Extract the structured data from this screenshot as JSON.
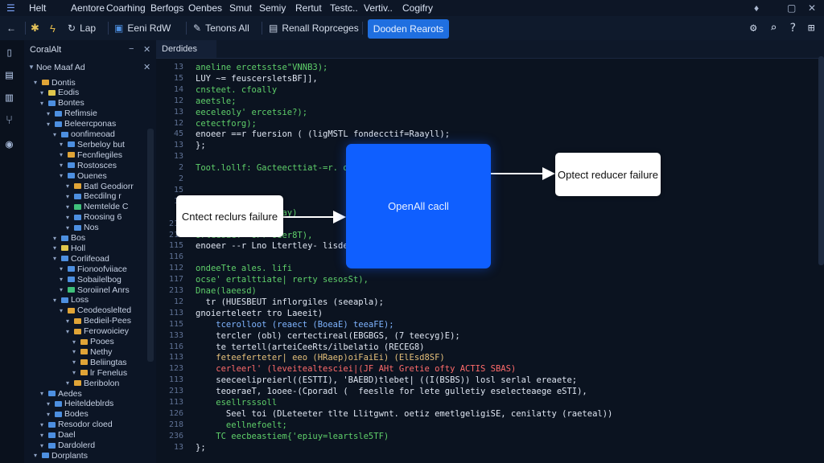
{
  "menu": [
    "Helt",
    "Aentore",
    "Coarhing",
    "Berfogs",
    "Oenbes",
    "Smut",
    "Semiy",
    "Rertut",
    "Testc..",
    "Vertiv..",
    "Cogifry"
  ],
  "toolbar": {
    "lap_label": "Lap",
    "eeni_label": "Eeni RdW",
    "tenons_label": "Tenons All",
    "renall_label": "Renall Roprceges",
    "primary_label": "Dooden Rearots"
  },
  "explorer": {
    "title": "CoralAlt",
    "root_label": "Noe Maaf Ad",
    "items": [
      {
        "label": "Dontis",
        "depth": 0,
        "color": "#e0a437"
      },
      {
        "label": "Eodis",
        "depth": 1,
        "color": "#e0c64c"
      },
      {
        "label": "Bontes",
        "depth": 1,
        "color": "#4d8fe0"
      },
      {
        "label": "Refimsie",
        "depth": 2,
        "color": "#4d8fe0"
      },
      {
        "label": "Beleercponas",
        "depth": 2,
        "color": "#4d8fe0"
      },
      {
        "label": "oonfimeoad",
        "depth": 3,
        "color": "#4d8fe0"
      },
      {
        "label": "Serbeloy but",
        "depth": 4,
        "color": "#4d8fe0"
      },
      {
        "label": "Fecnfiegiles",
        "depth": 4,
        "color": "#e0a437"
      },
      {
        "label": "Rostosces",
        "depth": 4,
        "color": "#4d8fe0"
      },
      {
        "label": "Ouenes",
        "depth": 4,
        "color": "#4d8fe0"
      },
      {
        "label": "Batl Geodiorr",
        "depth": 5,
        "color": "#e0a437"
      },
      {
        "label": "Becdilng r",
        "depth": 5,
        "color": "#4d8fe0"
      },
      {
        "label": "Nemtelde C",
        "depth": 5,
        "color": "#3fc07a"
      },
      {
        "label": "Roosing 6",
        "depth": 5,
        "color": "#4d8fe0"
      },
      {
        "label": "Nos",
        "depth": 5,
        "color": "#4d8fe0"
      },
      {
        "label": "Bos",
        "depth": 3,
        "color": "#4d8fe0"
      },
      {
        "label": "Holl",
        "depth": 3,
        "color": "#e0c64c"
      },
      {
        "label": "Corlifeoad",
        "depth": 3,
        "color": "#4d8fe0"
      },
      {
        "label": "Fionoofviiace",
        "depth": 4,
        "color": "#4d8fe0"
      },
      {
        "label": "Sobailelbog",
        "depth": 4,
        "color": "#4d8fe0"
      },
      {
        "label": "Soroiinel Anrs",
        "depth": 4,
        "color": "#3fc07a"
      },
      {
        "label": "Loss",
        "depth": 3,
        "color": "#4d8fe0"
      },
      {
        "label": "Ceodeoslelted",
        "depth": 4,
        "color": "#e0a437"
      },
      {
        "label": "Bedieil-Pees",
        "depth": 5,
        "color": "#e0a437"
      },
      {
        "label": "Ferowoiciey",
        "depth": 5,
        "color": "#e0a437"
      },
      {
        "label": "Pooes",
        "depth": 6,
        "color": "#e0a437"
      },
      {
        "label": "Nethy",
        "depth": 6,
        "color": "#e0a437"
      },
      {
        "label": "Beliingtas",
        "depth": 6,
        "color": "#e0a437"
      },
      {
        "label": "lr Fenelus",
        "depth": 6,
        "color": "#e0a437"
      },
      {
        "label": "Beribolon",
        "depth": 5,
        "color": "#e0a437"
      },
      {
        "label": "Aedes",
        "depth": 1,
        "color": "#4d8fe0"
      },
      {
        "label": "Heiteldeblrds",
        "depth": 2,
        "color": "#4d8fe0"
      },
      {
        "label": "Bodes",
        "depth": 2,
        "color": "#4d8fe0"
      },
      {
        "label": "Resodor cloed",
        "depth": 1,
        "color": "#4d8fe0"
      },
      {
        "label": "Dael",
        "depth": 1,
        "color": "#4d8fe0"
      },
      {
        "label": "Dardolerd",
        "depth": 1,
        "color": "#4d8fe0"
      },
      {
        "label": "Dorplants",
        "depth": 0,
        "color": "#4d8fe0"
      }
    ]
  },
  "editor": {
    "tab_label": "Derdides",
    "lines": [
      {
        "n": "13",
        "t": "aneline ercetsstse\"VNNB3);",
        "c": "kw"
      },
      {
        "n": "15",
        "t": "LUY ~= feuscersletsBF]],",
        "c": ""
      },
      {
        "n": "14",
        "t": "cnsteet. cfoally",
        "c": "kw"
      },
      {
        "n": "12",
        "t": "aeetsle;",
        "c": "kw"
      },
      {
        "n": "13",
        "t": "eeceleoly' ercetsie?);",
        "c": "kw"
      },
      {
        "n": "12",
        "t": "cetectforg);",
        "c": "kw"
      },
      {
        "n": "45",
        "t": "enoeer ==r fuersion ( (ligMSTL fondecctif=Raayll);",
        "c": ""
      },
      {
        "n": "13",
        "t": "};",
        "c": ""
      },
      {
        "n": "13",
        "t": "",
        "c": ""
      },
      {
        "n": "2",
        "t": "Toot.lollf: Gacteecttiat-=r. ooet",
        "c": "kw"
      },
      {
        "n": "2",
        "t": "",
        "c": ""
      },
      {
        "n": "15",
        "t": "",
        "c": ""
      },
      {
        "n": "13",
        "t": "",
        "c": ""
      },
      {
        "n": "",
        "t": "Andsie arsteetlraay)",
        "c": "kw"
      },
      {
        "n": "213",
        "t": "",
        "c": ""
      },
      {
        "n": "218",
        "t": "orleesaeT =oFf oeer8T),",
        "c": "kw"
      },
      {
        "n": "115",
        "t": "enoeer --r Lno Ltertley- lisdes(EMBBS),AO)",
        "c": ""
      },
      {
        "n": "116",
        "t": "",
        "c": ""
      },
      {
        "n": "112",
        "t": "ondeeTte ales. lifi",
        "c": "kw"
      },
      {
        "n": "117",
        "t": "ocse' ertalttiate| rerty sesosSt),",
        "c": "kw"
      },
      {
        "n": "213",
        "t": "Dnae(laeesd)",
        "c": "kw"
      },
      {
        "n": "12",
        "t": "  tr (HUESBEUT inflorgiles (seeapla);",
        "c": ""
      },
      {
        "n": "113",
        "t": "gnoierteleetr tro Laeeit)",
        "c": ""
      },
      {
        "n": "115",
        "t": "    tcerolloot (reaect (BoeaE) teeaFE);",
        "c": "fn"
      },
      {
        "n": "133",
        "t": "    tercler (obl) certectireal(EBGBGS, (7 teecyg)E);",
        "c": ""
      },
      {
        "n": "116",
        "t": "    te tertell(arteiCeeRts/ilbelatio (RECEG8)",
        "c": ""
      },
      {
        "n": "113",
        "t": "    feteeferteter| eeo (HRaep)oiFaiEi) (ElEsd8SF)",
        "c": "str"
      },
      {
        "n": "123",
        "t": "    cerleerl' (leveitealtesciei|(JF AHt Gretie ofty ACTIS SBAS)",
        "c": "red"
      },
      {
        "n": "113",
        "t": "    seeceelipreierl((ESTTI), 'BAEBD)tlebet| ((I(BSBS)) losl serlal ereaete;",
        "c": ""
      },
      {
        "n": "213",
        "t": "    teoeraeT, 1ooee-(Cporadl (  feeslle for lete gulletiy eselecteaege eSTI),",
        "c": ""
      },
      {
        "n": "113",
        "t": "    esellrsssoll",
        "c": "kw"
      },
      {
        "n": "126",
        "t": "      Seel toi (DLeteeter tlte Llitgwnt. oetiz emetlgeligiSE, cenilatty (raeteal))",
        "c": ""
      },
      {
        "n": "218",
        "t": "      eellnefoelt;",
        "c": "kw"
      },
      {
        "n": "236",
        "t": "    TC eecbeastiem{'epiuy=leartsle5TF)",
        "c": "kw"
      },
      {
        "n": "13",
        "t": "};",
        "c": ""
      }
    ]
  },
  "diagram": {
    "left_label": "Cntect reclurs failure",
    "center_label": "OpenAll cacll",
    "right_label": "Optect reducer failure"
  }
}
